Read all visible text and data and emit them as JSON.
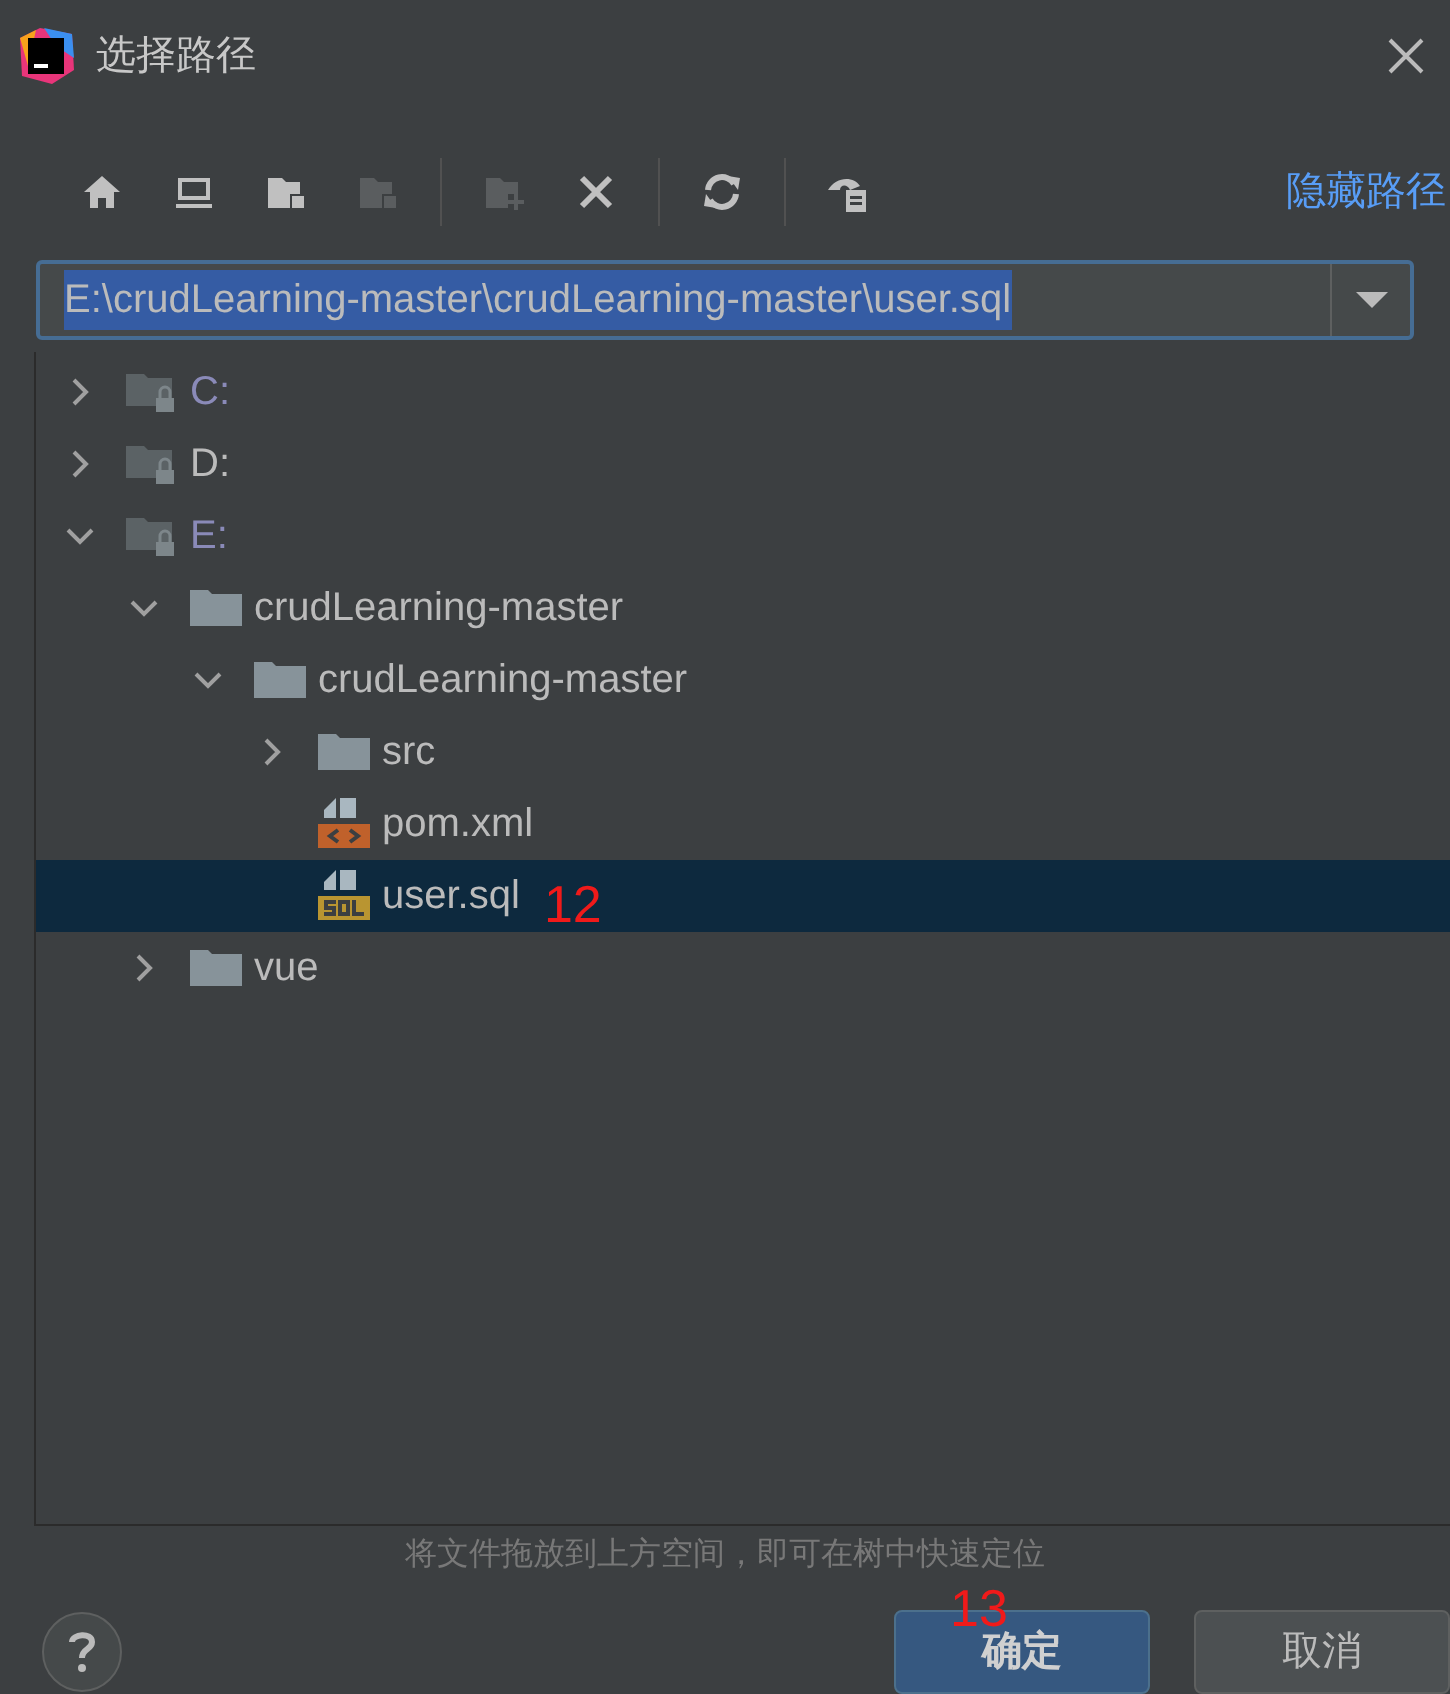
{
  "window": {
    "title": "选择路径"
  },
  "toolbar": {
    "groups": [
      [
        {
          "kind": "home",
          "disabled": false
        },
        {
          "kind": "desktop",
          "disabled": false
        },
        {
          "kind": "folder-file",
          "disabled": false
        },
        {
          "kind": "folder-blank",
          "disabled": true
        }
      ],
      [
        {
          "kind": "new-folder",
          "disabled": true
        },
        {
          "kind": "delete",
          "disabled": false
        }
      ],
      [
        {
          "kind": "refresh",
          "disabled": false
        }
      ],
      [
        {
          "kind": "show-hidden",
          "disabled": false
        }
      ]
    ],
    "toggle_path": "隐藏路径"
  },
  "path_field": {
    "value": "E:\\crudLearning-master\\crudLearning-master\\user.sql"
  },
  "tree": [
    {
      "label": "C:",
      "kind": "drive",
      "expanded": false,
      "dimmed": true,
      "selected": false
    },
    {
      "label": "D:",
      "kind": "drive",
      "expanded": false,
      "dimmed": false,
      "selected": false
    },
    {
      "label": "E:",
      "kind": "drive",
      "expanded": true,
      "dimmed": true,
      "selected": false,
      "children": [
        {
          "label": "crudLearning-master",
          "kind": "folder",
          "expanded": true,
          "dimmed": false,
          "selected": false,
          "children": [
            {
              "label": "crudLearning-master",
              "kind": "folder",
              "expanded": true,
              "dimmed": false,
              "selected": false,
              "children": [
                {
                  "label": "src",
                  "kind": "folder",
                  "expanded": false,
                  "dimmed": false,
                  "selected": false
                },
                {
                  "label": "pom.xml",
                  "kind": "xml",
                  "dimmed": false,
                  "selected": false
                },
                {
                  "label": "user.sql",
                  "kind": "sql",
                  "dimmed": false,
                  "selected": true,
                  "annotation": "12"
                }
              ]
            }
          ]
        },
        {
          "label": "vue",
          "kind": "folder",
          "expanded": false,
          "dimmed": false,
          "selected": false
        }
      ]
    }
  ],
  "hint": "将文件拖放到上方空间，即可在树中快速定位",
  "buttons": [
    {
      "label": "确定",
      "default": true,
      "annotation": "13"
    },
    {
      "label": "取消",
      "default": false
    }
  ]
}
